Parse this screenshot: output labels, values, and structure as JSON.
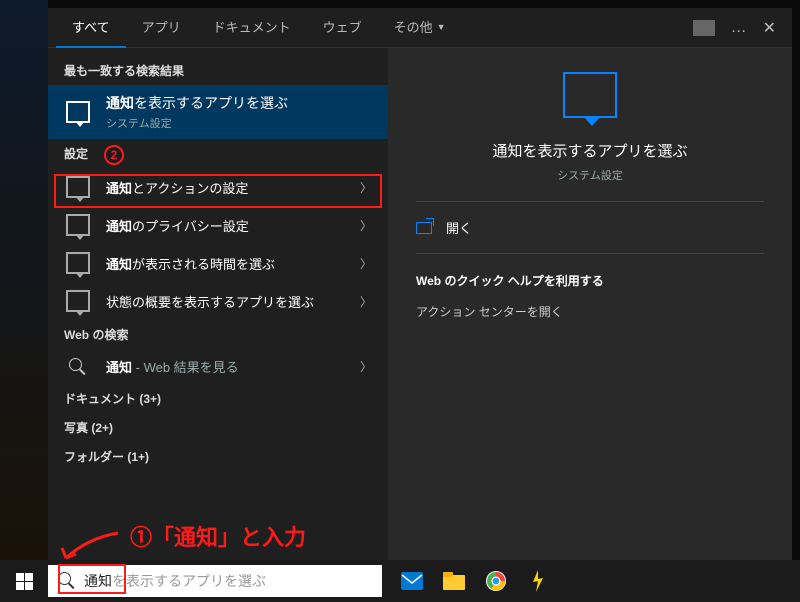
{
  "tabs": {
    "all": "すべて",
    "apps": "アプリ",
    "documents": "ドキュメント",
    "web": "ウェブ",
    "more": "その他"
  },
  "top_right": {
    "more_menu": "…",
    "close": "✕"
  },
  "left": {
    "best_match_header": "最も一致する検索結果",
    "best_match": {
      "title_prefix": "通知",
      "title_rest": "を表示するアプリを選ぶ",
      "subtitle": "システム設定"
    },
    "settings_header": "設定",
    "settings_items": [
      {
        "bold": "通知",
        "rest": "とアクションの設定"
      },
      {
        "bold": "通知",
        "rest": "のプライバシー設定"
      },
      {
        "bold": "通知",
        "rest": "が表示される時間を選ぶ"
      },
      {
        "bold": "",
        "rest": "状態の概要を表示するアプリを選ぶ"
      }
    ],
    "web_header": "Web の検索",
    "web_item": {
      "bold": "通知",
      "rest": " - Web 結果を見る"
    },
    "extras": [
      "ドキュメント (3+)",
      "写真 (2+)",
      "フォルダー (1+)"
    ]
  },
  "right": {
    "title": "通知を表示するアプリを選ぶ",
    "subtitle": "システム設定",
    "open": "開く",
    "quick_help_header": "Web のクイック ヘルプを利用する",
    "quick_links": [
      "アクション センターを開く"
    ]
  },
  "search_box": {
    "typed": "通知",
    "ghost": "を表示するアプリを選ぶ"
  },
  "annotations": {
    "step1": "①「通知」と入力",
    "step2": "②"
  }
}
